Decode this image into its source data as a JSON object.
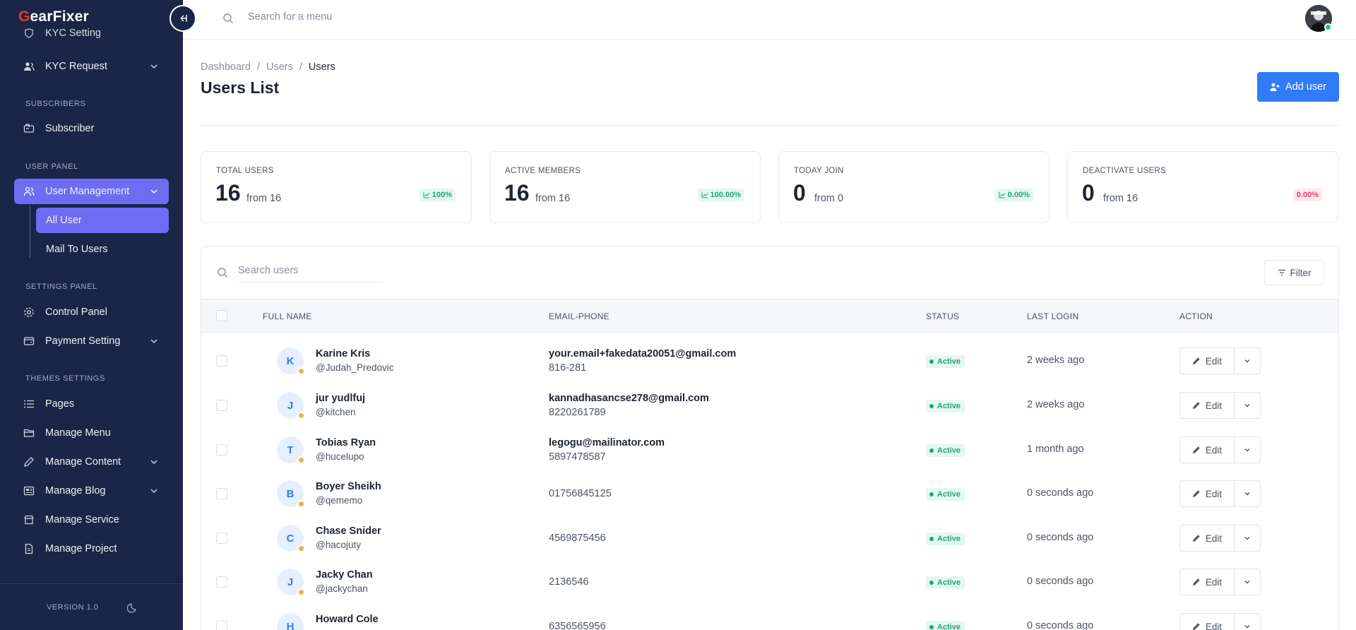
{
  "brand": {
    "name_first": "G",
    "name_rest": "earFixer"
  },
  "sidebar": {
    "partial_item": "KYC Setting",
    "kyc_request": "KYC Request",
    "sections": {
      "subscribers": "SUBSCRIBERS",
      "user_panel": "USER PANEL",
      "settings_panel": "SETTINGS PANEL",
      "themes_settings": "THEMES SETTINGS"
    },
    "subscriber": "Subscriber",
    "user_management": "User Management",
    "all_user": "All User",
    "mail_to_users": "Mail To Users",
    "control_panel": "Control Panel",
    "payment_setting": "Payment Setting",
    "pages": "Pages",
    "manage_menu": "Manage Menu",
    "manage_content": "Manage Content",
    "manage_blog": "Manage Blog",
    "manage_service": "Manage Service",
    "manage_project": "Manage Project",
    "version": "VERSION 1.0"
  },
  "topbar": {
    "search_placeholder": "Search for a menu"
  },
  "breadcrumb": [
    "Dashboard",
    "Users",
    "Users"
  ],
  "page": {
    "title": "Users List",
    "add_user": "Add user"
  },
  "stats": [
    {
      "label": "TOTAL USERS",
      "value": "16",
      "from": "from 16",
      "badge": "100%",
      "tone": "green"
    },
    {
      "label": "ACTIVE MEMBERS",
      "value": "16",
      "from": "from 16",
      "badge": "100.00%",
      "tone": "green"
    },
    {
      "label": "TODAY JOIN",
      "value": "0",
      "from": "from 0",
      "badge": "0.00%",
      "tone": "green"
    },
    {
      "label": "DEACTIVATE USERS",
      "value": "0",
      "from": "from 16",
      "badge": "0.00%",
      "tone": "red"
    }
  ],
  "table": {
    "search_placeholder": "Search users",
    "filter_label": "Filter",
    "columns": [
      "FULL NAME",
      "EMAIL-PHONE",
      "STATUS",
      "LAST LOGIN",
      "ACTION"
    ],
    "edit_label": "Edit",
    "rows": [
      {
        "initial": "K",
        "name": "Karine Kris",
        "handle": "@Judah_Predovic",
        "email": "your.email+fakedata20051@gmail.com",
        "phone": "816-281",
        "status": "Active",
        "last_login": "2 weeks ago"
      },
      {
        "initial": "J",
        "name": "jur yudlfuj",
        "handle": "@kitchen",
        "email": "kannadhasancse278@gmail.com",
        "phone": "8220261789",
        "status": "Active",
        "last_login": "2 weeks ago"
      },
      {
        "initial": "T",
        "name": "Tobias Ryan",
        "handle": "@hucelupo",
        "email": "legogu@mailinator.com",
        "phone": "5897478587",
        "status": "Active",
        "last_login": "1 month ago"
      },
      {
        "initial": "B",
        "name": "Boyer Sheikh",
        "handle": "@qememo",
        "email": "",
        "phone": "01756845125",
        "status": "Active",
        "last_login": "0 seconds ago"
      },
      {
        "initial": "C",
        "name": "Chase Snider",
        "handle": "@hacojuty",
        "email": "",
        "phone": "4569875456",
        "status": "Active",
        "last_login": "0 seconds ago"
      },
      {
        "initial": "J",
        "name": "Jacky Chan",
        "handle": "@jackychan",
        "email": "",
        "phone": "2136546",
        "status": "Active",
        "last_login": "0 seconds ago"
      },
      {
        "initial": "H",
        "name": "Howard Cole",
        "handle": "",
        "email": "",
        "phone": "6356565956",
        "status": "Active",
        "last_login": "0 seconds ago"
      }
    ]
  },
  "colors": {
    "sidebar_bg": "#1a2547",
    "accent": "#6e6cf2",
    "primary": "#2f7cf6",
    "success": "#1ea67a",
    "danger": "#e0466b"
  }
}
